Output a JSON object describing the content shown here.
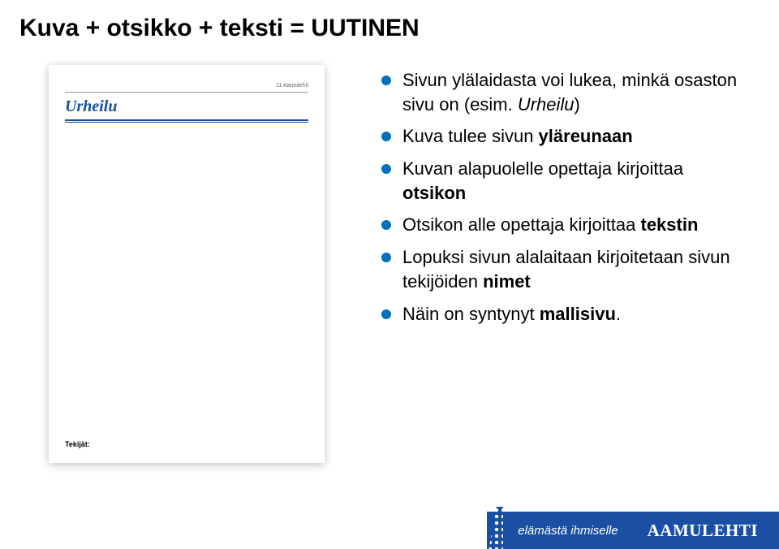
{
  "title": "Kuva + otsikko + teksti = UUTINEN",
  "preview": {
    "topmeta": "11  Aamulehti",
    "section": "Urheilu",
    "footer_label": "Tekijät:"
  },
  "bullets": {
    "b1a": "Sivun ylälaidasta voi lukea, minkä osaston sivu on (esim. ",
    "b1b": "Urheilu",
    "b1c": ")",
    "b2a": "Kuva tulee sivun ",
    "b2b": "yläreunaan",
    "b3a": "Kuvan alapuolelle opettaja kirjoittaa ",
    "b3b": "otsikon",
    "b4a": "Otsikon alle opettaja kirjoittaa ",
    "b4b": "tekstin",
    "b5a": "Lopuksi sivun alalaitaan kirjoitetaan sivun tekijöiden ",
    "b5b": "nimet",
    "b6a": "Näin on syntynyt ",
    "b6b": "mallisivu",
    "b6c": "."
  },
  "footer": {
    "tagline": "elämästä ihmiselle",
    "brand": "AAMULEHTI"
  }
}
